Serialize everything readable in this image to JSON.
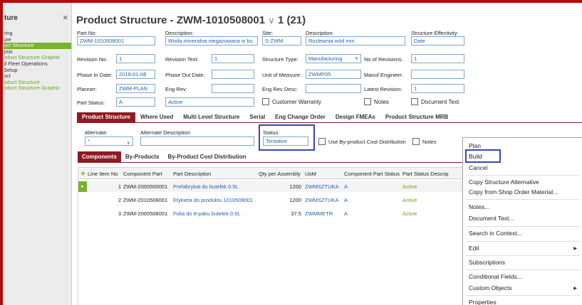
{
  "nav": {
    "title": "ture",
    "close_icon": "×",
    "items": [
      {
        "label": "ring",
        "style": "plain"
      },
      {
        "label": "ure",
        "style": "plain"
      },
      {
        "label": "uct Structure",
        "style": "active"
      },
      {
        "label": "ysis",
        "style": "plain"
      },
      {
        "label": "oduct Structure Graphic",
        "style": "green"
      },
      {
        "label": "d Fleet Operations",
        "style": "plain"
      },
      {
        "label": "Setup",
        "style": "plain"
      },
      {
        "label": "uct",
        "style": "plain"
      },
      {
        "label": "oduct Structure",
        "style": "green"
      },
      {
        "label": "oduct Structure Graphic",
        "style": "green"
      }
    ]
  },
  "header": {
    "title": "Product Structure - ZWM-1010508001",
    "chevron": "∨",
    "title_suffix": "1 (21)"
  },
  "fields": {
    "part_no_label": "Part No:",
    "part_no": "ZWM-1010508001",
    "description_label": "Description:",
    "description": "Woda mineralna niegazowana w bu",
    "site_label": "Site:",
    "site": "S-ZWM",
    "site_desc_label": "Description:",
    "site_desc": "Rozlewnia wód min.",
    "effectivity_label": "Structure Effectivity:",
    "effectivity": "Date",
    "revision_no_label": "Revision No:",
    "revision_no": "1",
    "revision_text_label": "Revision Text:",
    "revision_text": "1",
    "structure_type_label": "Structure Type:",
    "structure_type": "Manufacturing",
    "no_revisions_label": "No of Revisions:",
    "no_revisions": "1",
    "phase_in_label": "Phase In Date:",
    "phase_in": "2019-01-08",
    "phase_out_label": "Phase Out Date:",
    "phase_out": "",
    "uom_label": "Unit of Measure:",
    "uom": "ZWMP05",
    "manuf_engineer_label": "Manuf Engineer:",
    "manuf_engineer": "",
    "planner_label": "Planner:",
    "planner": "ZWM-PLAN",
    "eng_rev_label": "Eng Rev:",
    "eng_rev": "",
    "eng_rev_desc_label": "Eng Rev Desc:",
    "eng_rev_desc": "",
    "latest_revision_label": "Latest Revision:",
    "latest_revision": "1",
    "part_status_label": "Part Status:",
    "part_status": "A",
    "part_status_desc": "Active",
    "customer_warranty_label": "Customer Warranty",
    "notes_label": "Notes",
    "document_text_label": "Document Text"
  },
  "tabs": [
    "Product Structure",
    "Where Used",
    "Multi Level Structure",
    "Serial",
    "Eng Change Order",
    "Design FMEAs",
    "Product Structure MRB"
  ],
  "alt": {
    "alternate_label": "Alternate:",
    "alternate": "*",
    "alt_desc_label": "Alternate Description:",
    "alt_desc": "",
    "status_label": "Status:",
    "status": "Tentative",
    "byproduct_label": "Use By-product Cost Distribution",
    "notes_label": "Notes"
  },
  "subtabs": [
    "Components",
    "By-Products",
    "By-Product Cost Distribution"
  ],
  "grid": {
    "add_icon": "+",
    "columns": [
      "Line Item No",
      "Component Part",
      "Part Description",
      "Qty per Assembly",
      "UoM",
      "Component Part Status",
      "Part Status Descrip"
    ],
    "cut_column": "C",
    "rows": [
      {
        "line": "1",
        "part": "ZWM-2000500001",
        "desc": "Prefabrykat do butelek 0.5L",
        "qty": "1200",
        "uom": "ZWMSZTUKA",
        "status": "A",
        "status_desc": "Active"
      },
      {
        "line": "2",
        "part": "ZWM-2010508001",
        "desc": "Etykieta do produktu 1010508001",
        "qty": "1200",
        "uom": "ZWMSZTUKA",
        "status": "A",
        "status_desc": "Active"
      },
      {
        "line": "3",
        "part": "ZWM-2000508001",
        "desc": "Folia do 8-paku butelek 0.5L",
        "qty": "37.5",
        "uom": "ZWMMETR",
        "status": "A",
        "status_desc": "Active"
      }
    ]
  },
  "menu": {
    "plan": "Plan",
    "build": "Build",
    "cancel": "Cancel",
    "copy_alt": "Copy Structure Alternative",
    "copy_shop": "Copy from Shop Order Material...",
    "notes": "Notes...",
    "doc_text": "Document Text...",
    "search": "Search in Context...",
    "edit": "Edit",
    "subscriptions": "Subscriptions",
    "conditional": "Conditional Fields...",
    "custom": "Custom Objects",
    "properties": "Properties",
    "submenu_arrow": "▶"
  },
  "colors": {
    "accent": "#8e1a22",
    "green": "#7ab02d",
    "highlight": "#3946b2",
    "frame": "#b10d0d"
  }
}
